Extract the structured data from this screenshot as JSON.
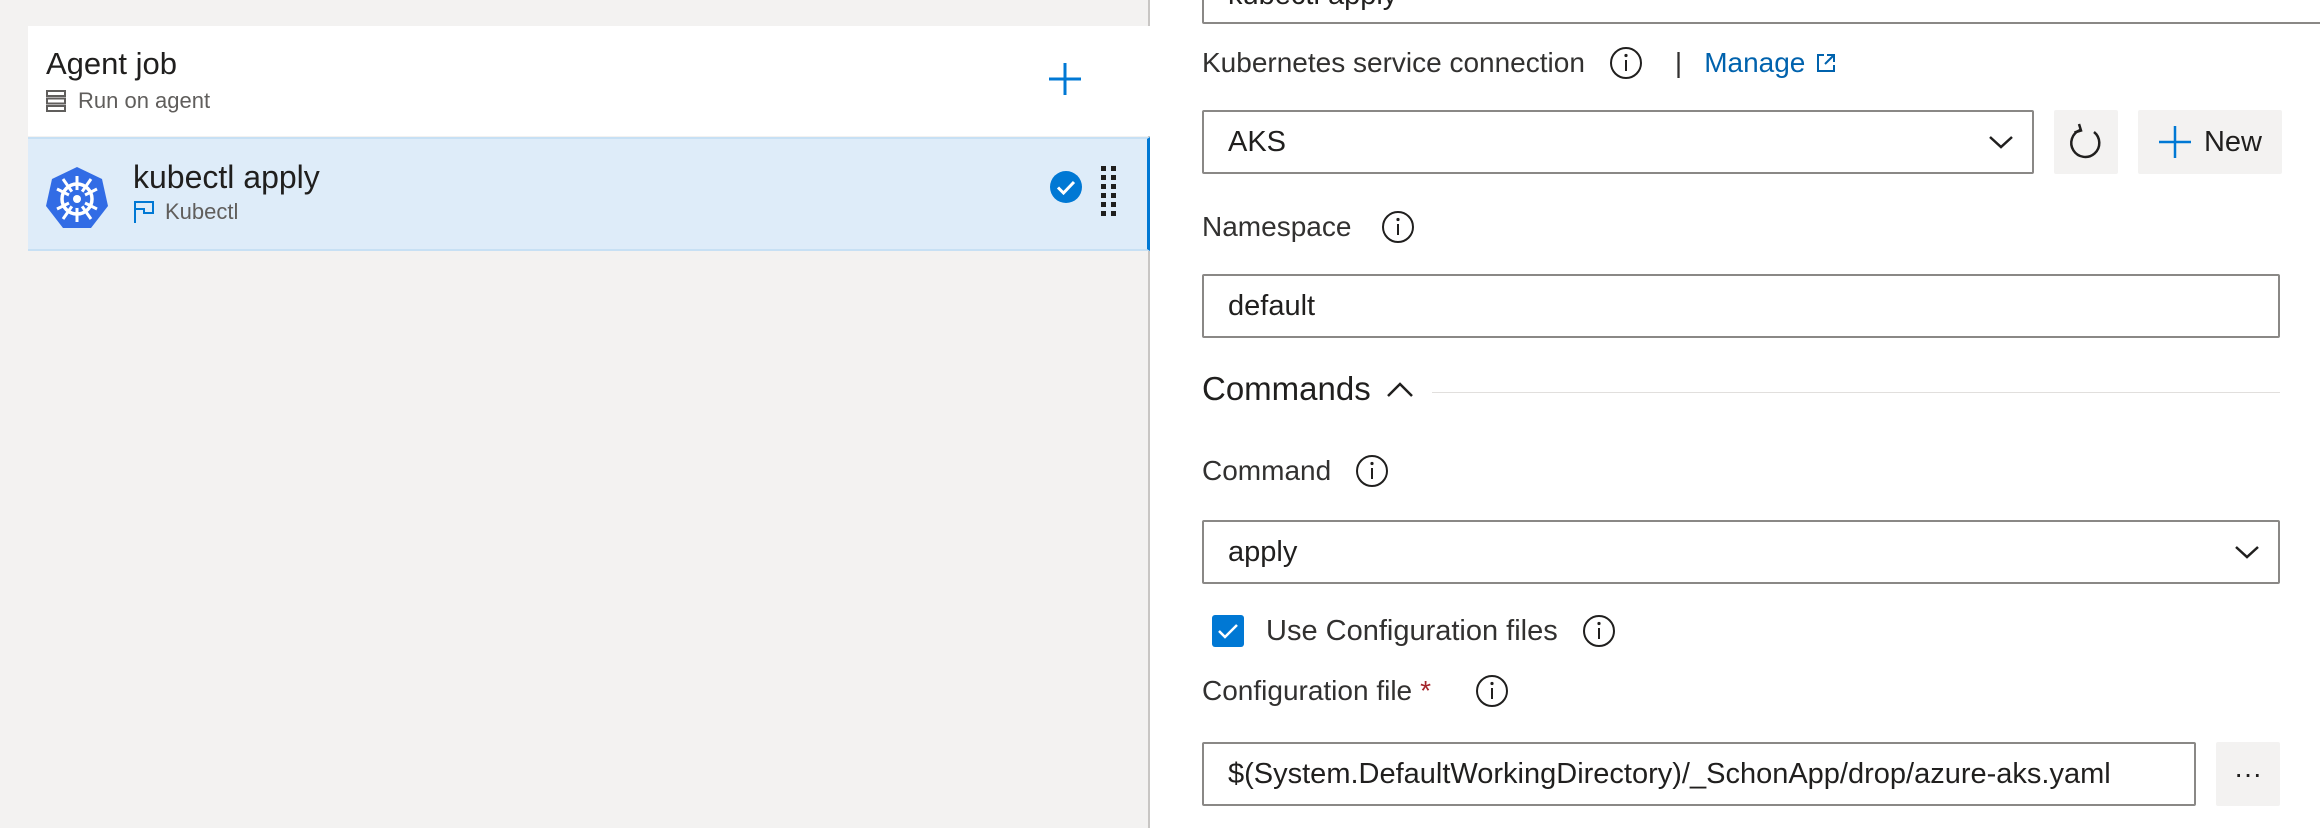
{
  "left": {
    "agent_job": {
      "title": "Agent job",
      "subtitle": "Run on agent"
    },
    "task": {
      "title": "kubectl apply",
      "subtitle": "Kubectl"
    }
  },
  "form": {
    "top_field_value": "kubectl apply",
    "service_connection": {
      "label": "Kubernetes service connection",
      "manage_label": "Manage",
      "value": "AKS",
      "new_label": "New"
    },
    "namespace": {
      "label": "Namespace",
      "value": "default"
    },
    "commands_section": {
      "title": "Commands"
    },
    "command": {
      "label": "Command",
      "value": "apply"
    },
    "use_config": {
      "label": "Use Configuration files",
      "checked": true
    },
    "config_file": {
      "label": "Configuration file",
      "required_mark": "*",
      "value": "$(System.DefaultWorkingDirectory)/_SchonApp/drop/azure-aks.yaml",
      "browse_label": "···"
    }
  },
  "colors": {
    "accent": "#0078d4",
    "link": "#0062ad",
    "selected_row": "#deecf9",
    "pane_bg": "#f3f2f1",
    "required": "#a4262c"
  }
}
